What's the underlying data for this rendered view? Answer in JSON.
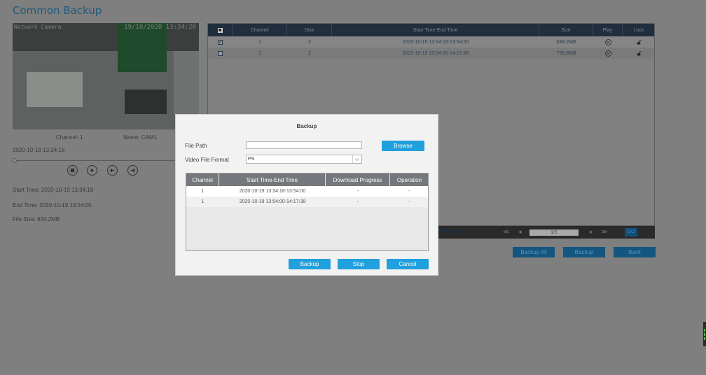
{
  "page": {
    "title": "Common Backup"
  },
  "preview": {
    "osd_left": "Network Camera",
    "osd_right": "19/10/2020 13:34:26",
    "channel": "Channel: 1",
    "name": "Name: CAM1",
    "current_time": "2020-10-19 13:34:18",
    "start_time": "Start Time: 2020-10-19 13:34:18",
    "end_time": "End Time: 2020-10-19 13:54:00",
    "file_size": "File Size: 634.2MB"
  },
  "records": {
    "columns": [
      "Channel",
      "Disk",
      "Start Time-End Time",
      "Size",
      "Play",
      "Lock"
    ],
    "rows": [
      {
        "checked": true,
        "channel": "1",
        "disk": "2",
        "time": "2020-10-19 13:34:18-13:54:00",
        "size": "634.2MB"
      },
      {
        "checked": false,
        "channel": "1",
        "disk": "2",
        "time": "2020-10-19 13:54:00-14:17:38",
        "size": "759.8MB"
      }
    ],
    "header_check": "■",
    "row0_check": "✓",
    "row1_check": ""
  },
  "pager": {
    "total": "Total:2 Item(s)",
    "page": "1/1",
    "go": "GO"
  },
  "actions": {
    "backup_all": "Backup All",
    "backup": "Backup",
    "back": "Back"
  },
  "dialog": {
    "title": "Backup",
    "file_path_label": "File Path",
    "file_path_value": "",
    "browse": "Browse",
    "format_label": "Video File Format",
    "format_value": "PS",
    "columns": [
      "Channel",
      "Start Time-End Time",
      "Download Progress",
      "Operation"
    ],
    "rows": [
      {
        "channel": "1",
        "time": "2020-10-19 13:34:18-13:54:00",
        "progress": "-",
        "operation": "-"
      },
      {
        "channel": "1",
        "time": "2020-10-19 13:54:00-14:17:38",
        "progress": "-",
        "operation": "-"
      }
    ],
    "buttons": {
      "backup": "Backup",
      "stop": "Stop",
      "cancel": "Cancel"
    }
  },
  "colors": {
    "accent": "#20a0dd",
    "header_dark": "#202e3e",
    "dim_button": "#13567f"
  }
}
